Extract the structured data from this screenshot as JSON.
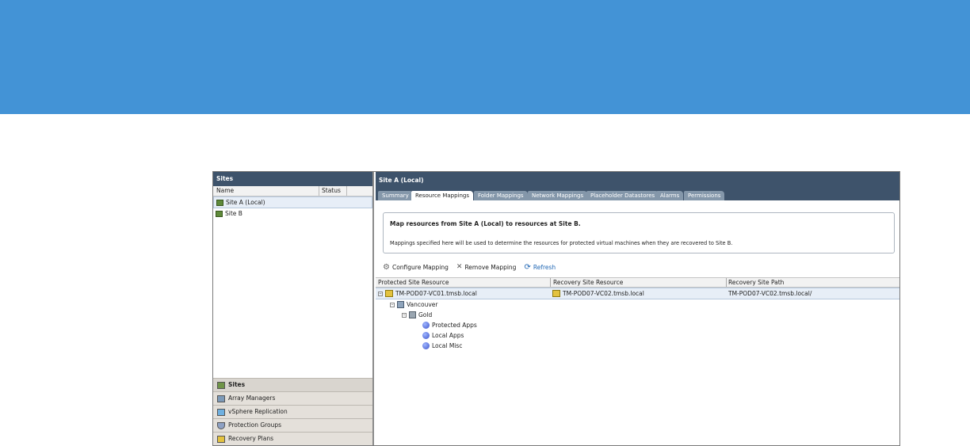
{
  "left_panel": {
    "title": "Sites",
    "columns": [
      "Name",
      "Status"
    ],
    "sites": [
      {
        "name": "Site A (Local)",
        "selected": true
      },
      {
        "name": "Site B",
        "selected": false
      }
    ],
    "nav": [
      {
        "label": "Sites",
        "icon": "sites-icon",
        "active": true
      },
      {
        "label": "Array Managers",
        "icon": "array-manager-icon",
        "active": false
      },
      {
        "label": "vSphere Replication",
        "icon": "replication-icon",
        "active": false
      },
      {
        "label": "Protection Groups",
        "icon": "shield-icon",
        "active": false
      },
      {
        "label": "Recovery Plans",
        "icon": "recovery-plan-icon",
        "active": false
      }
    ]
  },
  "right_panel": {
    "title": "Site A (Local)",
    "tabs": [
      "Summary",
      "Resource Mappings",
      "Folder Mappings",
      "Network Mappings",
      "Placeholder Datastores",
      "Alarms",
      "Permissions"
    ],
    "active_tab": "Resource Mappings",
    "info_title": "Map resources from Site A (Local) to resources at Site B.",
    "info_text": "Mappings specified here will be used to determine the resources for protected virtual machines when they are recovered to Site B.",
    "toolbar": {
      "configure": "Configure Mapping",
      "remove": "Remove Mapping",
      "refresh": "Refresh"
    },
    "grid": {
      "columns": [
        "Protected Site Resource",
        "Recovery Site Resource",
        "Recovery Site Path"
      ],
      "rows": [
        {
          "protected": "TM-POD07-VC01.tmsb.local",
          "recovery": "TM-POD07-VC02.tmsb.local",
          "path": "TM-POD07-VC02.tmsb.local/"
        }
      ],
      "tree": [
        "Vancouver",
        "Gold",
        "Protected Apps",
        "Local Apps",
        "Local Misc"
      ]
    }
  },
  "colors": {
    "banner": "#4393d6",
    "header": "#3e536b",
    "tab_inactive": "#8497aa",
    "selection": "#e7eef7"
  }
}
